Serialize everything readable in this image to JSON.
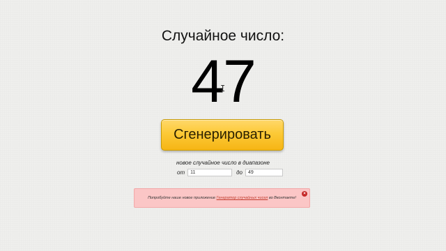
{
  "heading": "Случайное число:",
  "result": "47",
  "generate_button_label": "Сгенерировать",
  "range": {
    "caption": "новое случайное число в диапазоне",
    "from_label": "от",
    "from_value": "11",
    "to_label": "до",
    "to_value": "49"
  },
  "notice": {
    "text_before": "Попробуйте наше новое приложение ",
    "link_text": "Генератор случайных чисел",
    "text_after": " во Вконтакте!",
    "close_glyph": "×"
  },
  "cursor_glyph": "I",
  "colors": {
    "button_top": "#ffd86a",
    "button_bottom": "#f6b515",
    "notice_bg": "#fbc6c6",
    "notice_link": "#c0392b",
    "close_icon": "#c62828"
  },
  "icons": {
    "close": "close-icon",
    "cursor": "text-cursor-icon"
  }
}
